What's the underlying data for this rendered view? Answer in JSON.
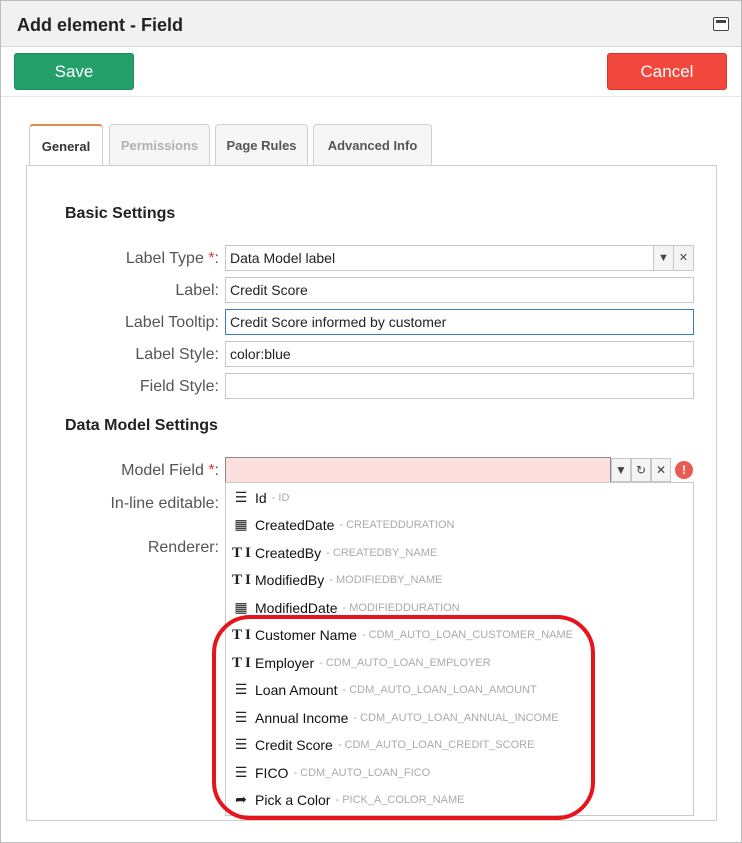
{
  "dialog": {
    "title": "Add element - Field"
  },
  "toolbar": {
    "save_label": "Save",
    "cancel_label": "Cancel"
  },
  "tabs": [
    {
      "label": "General",
      "state": "active"
    },
    {
      "label": "Permissions",
      "state": "disabled"
    },
    {
      "label": "Page Rules",
      "state": "normal"
    },
    {
      "label": "Advanced Info",
      "state": "normal"
    }
  ],
  "basic_settings": {
    "title": "Basic Settings",
    "label_type": {
      "label": "Label Type",
      "value": "Data Model label"
    },
    "label": {
      "label": "Label:",
      "value": "Credit Score"
    },
    "label_tooltip": {
      "label": "Label Tooltip:",
      "value": "Credit Score informed by customer"
    },
    "label_style": {
      "label": "Label Style:",
      "value": "color:blue"
    },
    "field_style": {
      "label": "Field Style:",
      "value": ""
    }
  },
  "data_model_settings": {
    "title": "Data Model Settings",
    "model_field": {
      "label": "Model Field",
      "value": ""
    },
    "inline_editable": {
      "label": "In-line editable:"
    },
    "renderer": {
      "label": "Renderer:"
    }
  },
  "required_marker": "*",
  "colon": ":",
  "dropdown": {
    "items": [
      {
        "name": "Id",
        "code": "- ID",
        "icon": "list-icon"
      },
      {
        "name": "CreatedDate",
        "code": "- CREATEDDURATION",
        "icon": "calendar-icon"
      },
      {
        "name": "CreatedBy",
        "code": "- CREATEDBY_NAME",
        "icon": "text-type-icon"
      },
      {
        "name": "ModifiedBy",
        "code": "- MODIFIEDBY_NAME",
        "icon": "text-type-icon"
      },
      {
        "name": "ModifiedDate",
        "code": "- MODIFIEDDURATION",
        "icon": "calendar-icon"
      },
      {
        "name": "Customer Name",
        "code": "- CDM_AUTO_LOAN_CUSTOMER_NAME",
        "icon": "text-type-icon"
      },
      {
        "name": "Employer",
        "code": "- CDM_AUTO_LOAN_EMPLOYER",
        "icon": "text-type-icon"
      },
      {
        "name": "Loan Amount",
        "code": "- CDM_AUTO_LOAN_LOAN_AMOUNT",
        "icon": "list-icon"
      },
      {
        "name": "Annual Income",
        "code": "- CDM_AUTO_LOAN_ANNUAL_INCOME",
        "icon": "list-icon"
      },
      {
        "name": "Credit Score",
        "code": "- CDM_AUTO_LOAN_CREDIT_SCORE",
        "icon": "list-icon"
      },
      {
        "name": "FICO",
        "code": "- CDM_AUTO_LOAN_FICO",
        "icon": "list-icon"
      },
      {
        "name": "Pick a Color",
        "code": "- PICK_A_COLOR_NAME",
        "icon": "share-arrow-icon"
      }
    ]
  },
  "colors": {
    "save": "#23a06a",
    "cancel": "#f2473d",
    "required": "#e53935",
    "error_fill": "#fde0de",
    "highlight": "#e8141c"
  }
}
